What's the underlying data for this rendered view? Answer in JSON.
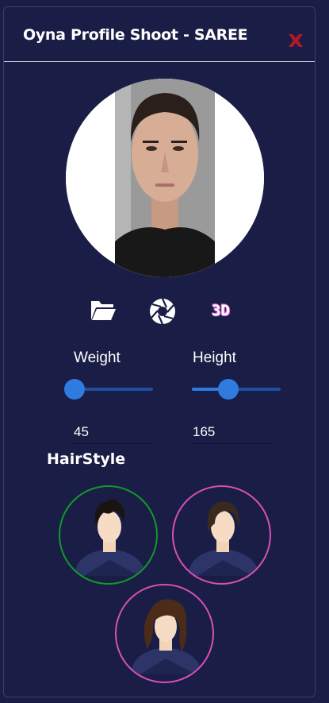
{
  "window": {
    "title": "Oyna Profile Shoot - SAREE",
    "close_icon": "close-x-icon"
  },
  "toolbar": {
    "folder_icon": "folder-open-icon",
    "camera_icon": "camera-aperture-icon",
    "view_3d_label": "3D"
  },
  "measurements": {
    "weight": {
      "label": "Weight",
      "value": "45",
      "slider_fraction": 0.0
    },
    "height": {
      "label": "Height",
      "value": "165",
      "slider_fraction": 0.38
    }
  },
  "hairstyle": {
    "title": "HairStyle",
    "options": [
      {
        "name": "short spiky",
        "selected": true
      },
      {
        "name": "side bangs",
        "selected": false
      },
      {
        "name": "long wavy",
        "selected": false
      }
    ]
  },
  "colors": {
    "background": "#1a1d45",
    "slider_blue": "#2f7be0",
    "selected_ring": "#109a2a",
    "option_ring": "#d94fb5",
    "close_red": "#b3182a",
    "label_3d": "#e070d8"
  }
}
